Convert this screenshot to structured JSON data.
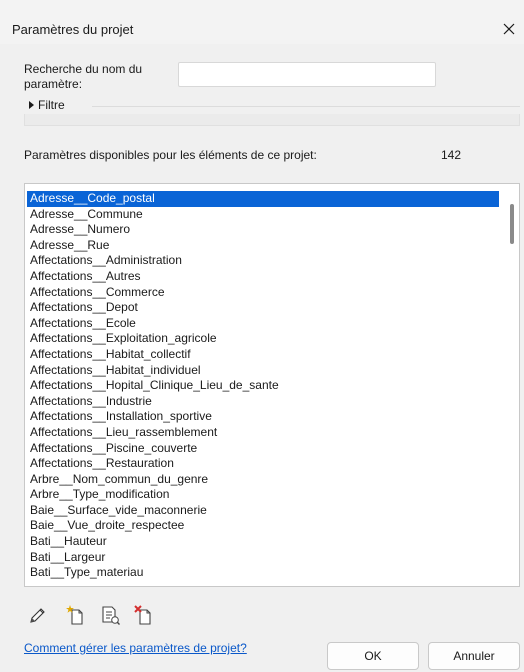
{
  "window": {
    "title": "Paramètres du projet",
    "close_glyph": "×"
  },
  "search": {
    "label": "Recherche du nom du paramètre:",
    "value": ""
  },
  "filter": {
    "label": "Filtre"
  },
  "available": {
    "label": "Paramètres disponibles pour les éléments de ce projet:",
    "count": "142"
  },
  "params": {
    "selected_index": 0,
    "items": [
      "Adresse__Code_postal",
      "Adresse__Commune",
      "Adresse__Numero",
      "Adresse__Rue",
      "Affectations__Administration",
      "Affectations__Autres",
      "Affectations__Commerce",
      "Affectations__Depot",
      "Affectations__Ecole",
      "Affectations__Exploitation_agricole",
      "Affectations__Habitat_collectif",
      "Affectations__Habitat_individuel",
      "Affectations__Hopital_Clinique_Lieu_de_sante",
      "Affectations__Industrie",
      "Affectations__Installation_sportive",
      "Affectations__Lieu_rassemblement",
      "Affectations__Piscine_couverte",
      "Affectations__Restauration",
      "Arbre__Nom_commun_du_genre",
      "Arbre__Type_modification",
      "Baie__Surface_vide_maconnerie",
      "Baie__Vue_droite_respectee",
      "Bati__Hauteur",
      "Bati__Largeur",
      "Bati__Type_materiau"
    ]
  },
  "toolbar": {
    "icons": [
      "pencil-icon",
      "new-parameter-icon",
      "edit-parameters-icon",
      "delete-parameter-icon"
    ]
  },
  "footer": {
    "help_link": "Comment gérer les paramètres de projet?",
    "ok_label": "OK",
    "cancel_label": "Annuler"
  },
  "colors": {
    "selection": "#0a64d6",
    "link": "#0a58c9",
    "delete_mark": "#d32f2f",
    "star": "#e0a800"
  }
}
